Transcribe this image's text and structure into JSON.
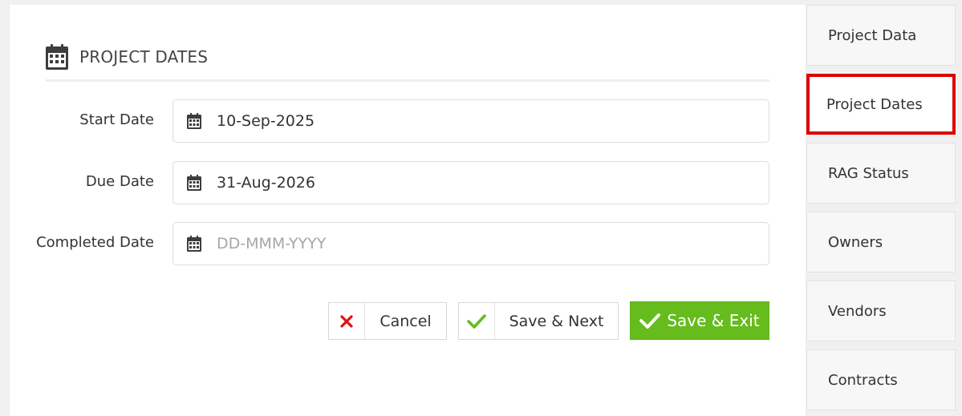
{
  "section": {
    "title": "PROJECT DATES",
    "icon": "calendar-icon"
  },
  "fields": [
    {
      "label": "Start Date",
      "value": "10-Sep-2025",
      "placeholder": "DD-MMM-YYYY"
    },
    {
      "label": "Due Date",
      "value": "31-Aug-2026",
      "placeholder": "DD-MMM-YYYY"
    },
    {
      "label": "Completed Date",
      "value": "",
      "placeholder": "DD-MMM-YYYY"
    }
  ],
  "buttons": {
    "cancel": "Cancel",
    "save_next": "Save & Next",
    "save_exit": "Save & Exit"
  },
  "colors": {
    "primary_green": "#66bb1d",
    "check_green": "#66bb1d",
    "cancel_red": "#dd1111",
    "active_border": "#dd0000"
  },
  "sidebar": {
    "items": [
      {
        "label": "Project Data",
        "active": false
      },
      {
        "label": "Project Dates",
        "active": true
      },
      {
        "label": "RAG Status",
        "active": false
      },
      {
        "label": "Owners",
        "active": false
      },
      {
        "label": "Vendors",
        "active": false
      },
      {
        "label": "Contracts",
        "active": false
      }
    ]
  }
}
